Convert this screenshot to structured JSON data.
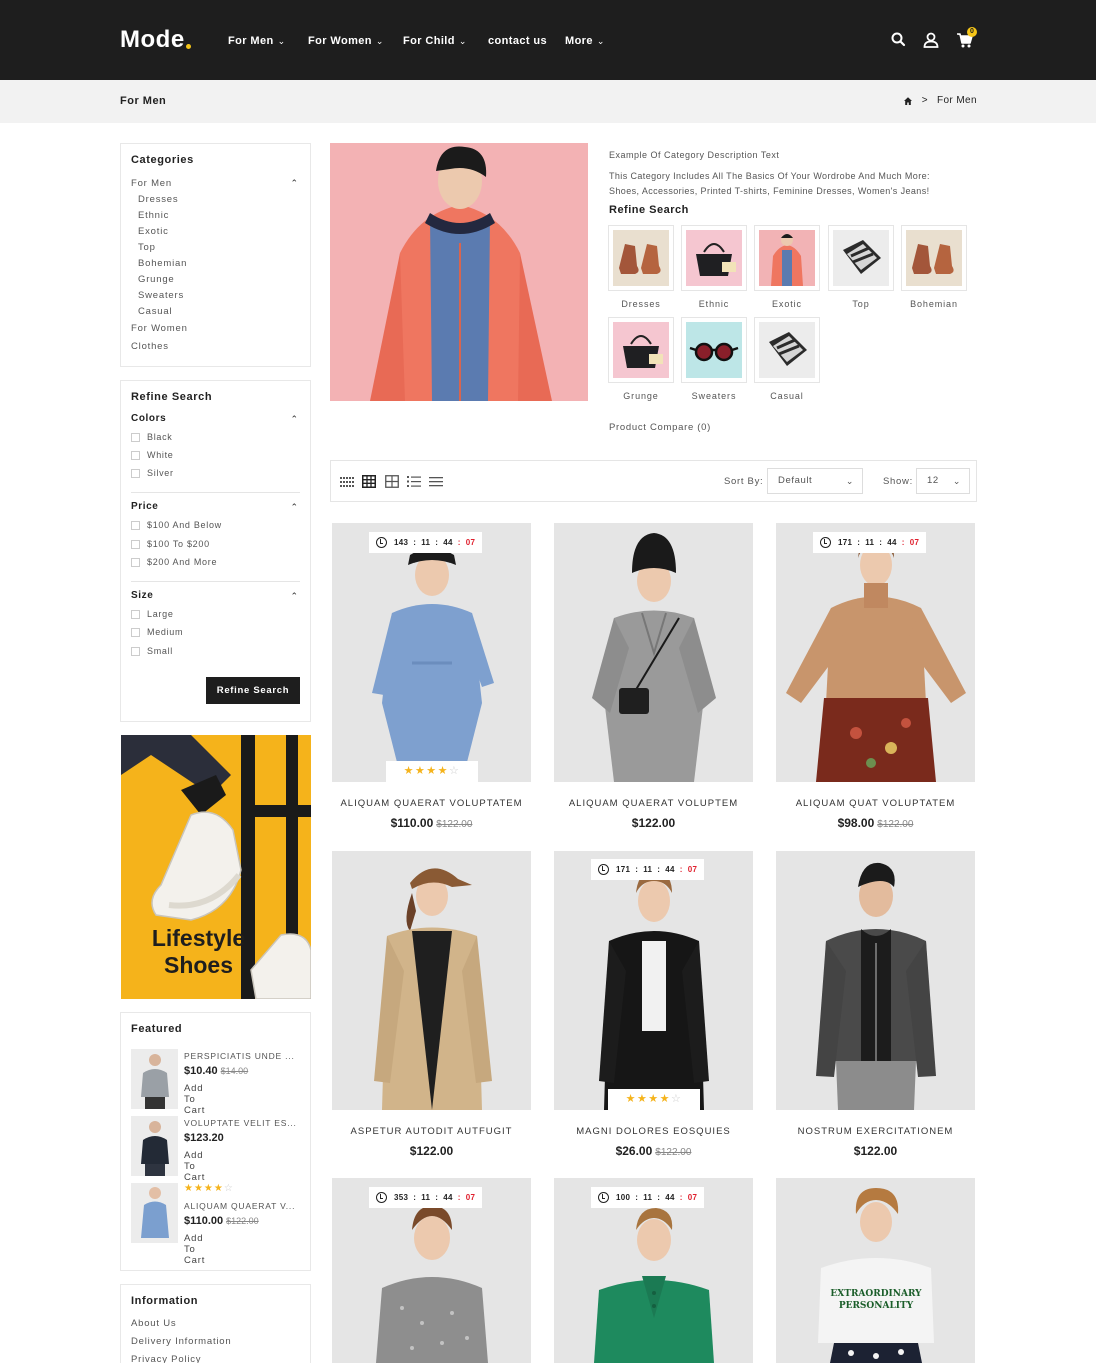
{
  "header": {
    "logo": "Mode",
    "nav": [
      {
        "label": "For Men",
        "dropdown": true
      },
      {
        "label": "For Women",
        "dropdown": true
      },
      {
        "label": "For Child",
        "dropdown": true
      },
      {
        "label": "contact us",
        "dropdown": false
      },
      {
        "label": "More",
        "dropdown": true
      }
    ],
    "icons": [
      "search-icon",
      "user-icon",
      "cart-icon"
    ],
    "cart_count": "0",
    "accent": "#f5c518",
    "bg": "#1e1e1e"
  },
  "breadcrumb": {
    "title": "For Men",
    "current": "For Men",
    "separator": ">"
  },
  "categories": {
    "title": "Categories",
    "items": [
      {
        "label": "For Men"
      },
      {
        "label": "Dresses"
      },
      {
        "label": "Ethnic"
      },
      {
        "label": "Exotic"
      },
      {
        "label": "Top"
      },
      {
        "label": "Bohemian"
      },
      {
        "label": "Grunge"
      },
      {
        "label": "Sweaters"
      },
      {
        "label": "Casual"
      },
      {
        "label": "For Women"
      },
      {
        "label": "Clothes"
      }
    ]
  },
  "refine": {
    "title": "Refine Search",
    "colors": {
      "title": "Colors",
      "options": [
        "Black",
        "White",
        "Silver"
      ]
    },
    "price": {
      "title": "Price",
      "options": [
        "$100 And Below",
        "$100 To $200",
        "$200 And More"
      ]
    },
    "size": {
      "title": "Size",
      "options": [
        "Large",
        "Medium",
        "Small"
      ]
    },
    "button": "Refine Search"
  },
  "banner": {
    "line1": "Lifestyle",
    "line2": "Shoes"
  },
  "featured": {
    "title": "Featured",
    "items": [
      {
        "name": "PERSPICIATIS UNDE ...",
        "price": "$10.40",
        "old_price": "$14.00",
        "cart": "Add To Cart",
        "rating": 0
      },
      {
        "name": "VOLUPTATE VELIT ES...",
        "price": "$123.20",
        "old_price": "",
        "cart": "Add To Cart",
        "rating": 0
      },
      {
        "name": "ALIQUAM QUAERAT V...",
        "price": "$110.00",
        "old_price": "$122.00",
        "cart": "Add To Cart",
        "rating": 4
      }
    ]
  },
  "information": {
    "title": "Information",
    "links": [
      "About Us",
      "Delivery Information",
      "Privacy Policy"
    ]
  },
  "category_info": {
    "desc_title": "Example Of Category Description Text",
    "desc_line1": "This Category Includes All The Basics Of Your Wordrobe And Much More:",
    "desc_line2": "Shoes, Accessories, Printed T-shirts, Feminine Dresses, Women's Jeans!",
    "refine_title": "Refine Search",
    "subcats": [
      "Dresses",
      "Ethnic",
      "Exotic",
      "Top",
      "Bohemian",
      "Grunge",
      "Sweaters",
      "Casual"
    ],
    "compare": "Product Compare (0)"
  },
  "toolbar": {
    "sort_label": "Sort By:",
    "sort_value": "Default",
    "show_label": "Show:",
    "show_value": "12"
  },
  "products": [
    {
      "name": "ALIQUAM QUAERAT VOLUPTATEM",
      "price": "$110.00",
      "old_price": "$122.00",
      "timer": [
        "143",
        "11",
        "44",
        "07"
      ],
      "rating": 4
    },
    {
      "name": "ALIQUAM QUAERAT VOLUPTEM",
      "price": "$122.00",
      "old_price": "",
      "timer": null,
      "rating": 0
    },
    {
      "name": "ALIQUAM QUAT VOLUPTATEM",
      "price": "$98.00",
      "old_price": "$122.00",
      "timer": [
        "171",
        "11",
        "44",
        "07"
      ],
      "rating": 0
    },
    {
      "name": "ASPETUR AUTODIT AUTFUGIT",
      "price": "$122.00",
      "old_price": "",
      "timer": null,
      "rating": 0
    },
    {
      "name": "MAGNI DOLORES EOSQUIES",
      "price": "$26.00",
      "old_price": "$122.00",
      "timer": [
        "171",
        "11",
        "44",
        "07"
      ],
      "rating": 4
    },
    {
      "name": "NOSTRUM EXERCITATIONEM",
      "price": "$122.00",
      "old_price": "",
      "timer": null,
      "rating": 0
    },
    {
      "name": "",
      "price": "",
      "old_price": "",
      "timer": [
        "353",
        "11",
        "44",
        "07"
      ],
      "rating": 0
    },
    {
      "name": "",
      "price": "",
      "old_price": "",
      "timer": [
        "100",
        "11",
        "44",
        "07"
      ],
      "rating": 0
    },
    {
      "name": "",
      "price": "",
      "old_price": "",
      "timer": null,
      "rating": 0
    }
  ],
  "tshirt_print": "EXTRAORDINARY PERSONALITY"
}
